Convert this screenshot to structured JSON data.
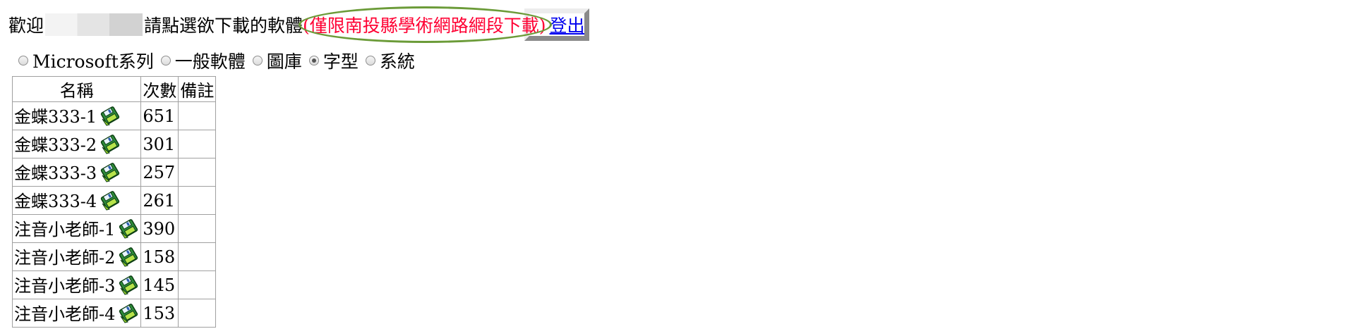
{
  "header": {
    "welcome_prefix": "歡迎",
    "welcome_suffix": "請點選欲下載的軟體",
    "notice": "(僅限南投縣學術網路網段下載)",
    "logout_label": "登出"
  },
  "categories": [
    {
      "label": "Microsoft系列",
      "checked": false
    },
    {
      "label": "一般軟體",
      "checked": false
    },
    {
      "label": "圖庫",
      "checked": false
    },
    {
      "label": "字型",
      "checked": true
    },
    {
      "label": "系統",
      "checked": false
    }
  ],
  "table": {
    "headers": [
      "名稱",
      "次數",
      "備註"
    ],
    "rows": [
      {
        "name": "金蝶333-1",
        "count": "651",
        "note": ""
      },
      {
        "name": "金蝶333-2",
        "count": "301",
        "note": ""
      },
      {
        "name": "金蝶333-3",
        "count": "257",
        "note": ""
      },
      {
        "name": "金蝶333-4",
        "count": "261",
        "note": ""
      },
      {
        "name": "注音小老師-1",
        "count": "390",
        "note": ""
      },
      {
        "name": "注音小老師-2",
        "count": "158",
        "note": ""
      },
      {
        "name": "注音小老師-3",
        "count": "145",
        "note": ""
      },
      {
        "name": "注音小老師-4",
        "count": "153",
        "note": ""
      }
    ]
  },
  "icons": {
    "download": "download-disk-icon"
  },
  "colors": {
    "notice": "#ff0033",
    "link": "#0000ee",
    "highlight_oval": "#6b9b38"
  }
}
